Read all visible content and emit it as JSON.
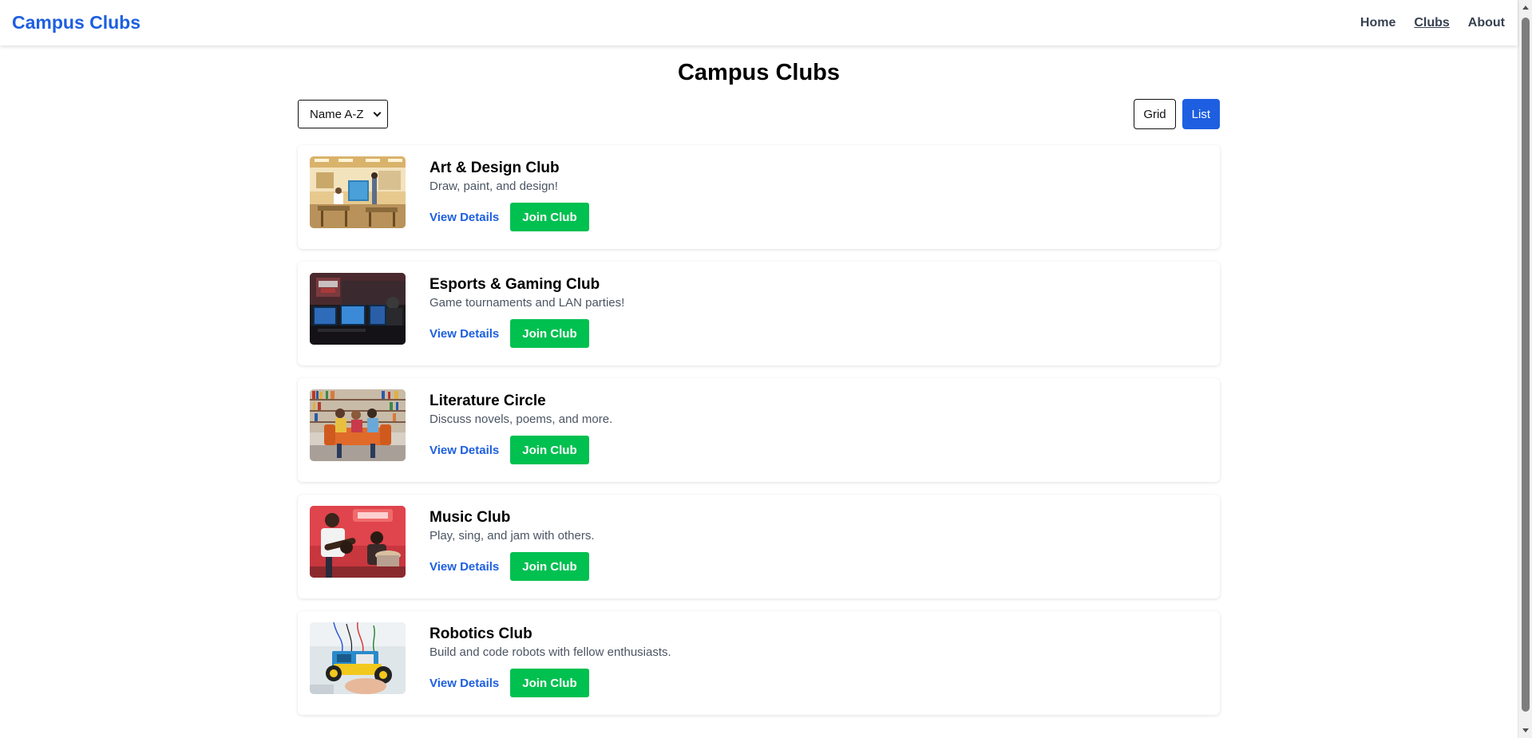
{
  "header": {
    "brand": "Campus Clubs",
    "nav": [
      {
        "label": "Home",
        "active": false
      },
      {
        "label": "Clubs",
        "active": true
      },
      {
        "label": "About",
        "active": false
      }
    ]
  },
  "main": {
    "title": "Campus Clubs",
    "sort": {
      "selected": "Name A-Z"
    },
    "view_toggle": {
      "grid_label": "Grid",
      "list_label": "List",
      "active": "List"
    },
    "clubs": [
      {
        "name": "Art & Design Club",
        "description": "Draw, paint, and design!",
        "details_label": "View Details",
        "join_label": "Join Club",
        "image_icon": "art-studio-photo"
      },
      {
        "name": "Esports & Gaming Club",
        "description": "Game tournaments and LAN parties!",
        "details_label": "View Details",
        "join_label": "Join Club",
        "image_icon": "gaming-setup-photo"
      },
      {
        "name": "Literature Circle",
        "description": "Discuss novels, poems, and more.",
        "details_label": "View Details",
        "join_label": "Join Club",
        "image_icon": "library-reading-photo"
      },
      {
        "name": "Music Club",
        "description": "Play, sing, and jam with others.",
        "details_label": "View Details",
        "join_label": "Join Club",
        "image_icon": "music-jam-photo"
      },
      {
        "name": "Robotics Club",
        "description": "Build and code robots with fellow enthusiasts.",
        "details_label": "View Details",
        "join_label": "Join Club",
        "image_icon": "robot-build-photo"
      }
    ]
  },
  "colors": {
    "brand": "#1d5fe0",
    "join_button": "#00c050",
    "list_toggle_active": "#1d5fe0",
    "text_muted": "#4b5563"
  }
}
